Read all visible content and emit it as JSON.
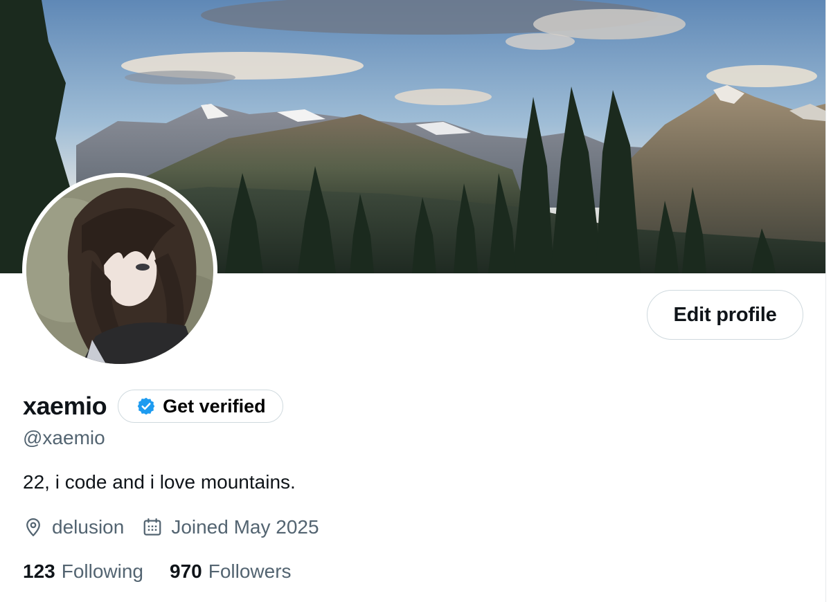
{
  "profile": {
    "display_name": "xaemio",
    "handle": "@xaemio",
    "bio": "22, i code and i love mountains.",
    "location": "delusion",
    "joined": "Joined May 2025",
    "following_count": "123",
    "following_label": "Following",
    "followers_count": "970",
    "followers_label": "Followers"
  },
  "actions": {
    "edit_profile_label": "Edit profile",
    "get_verified_label": "Get verified"
  },
  "icons": {
    "verified": "verified-badge-icon",
    "location": "location-pin-icon",
    "calendar": "calendar-icon"
  },
  "colors": {
    "text_primary": "#0f1419",
    "text_secondary": "#536471",
    "border": "#cfd9de",
    "verified_blue": "#1d9bf0"
  }
}
